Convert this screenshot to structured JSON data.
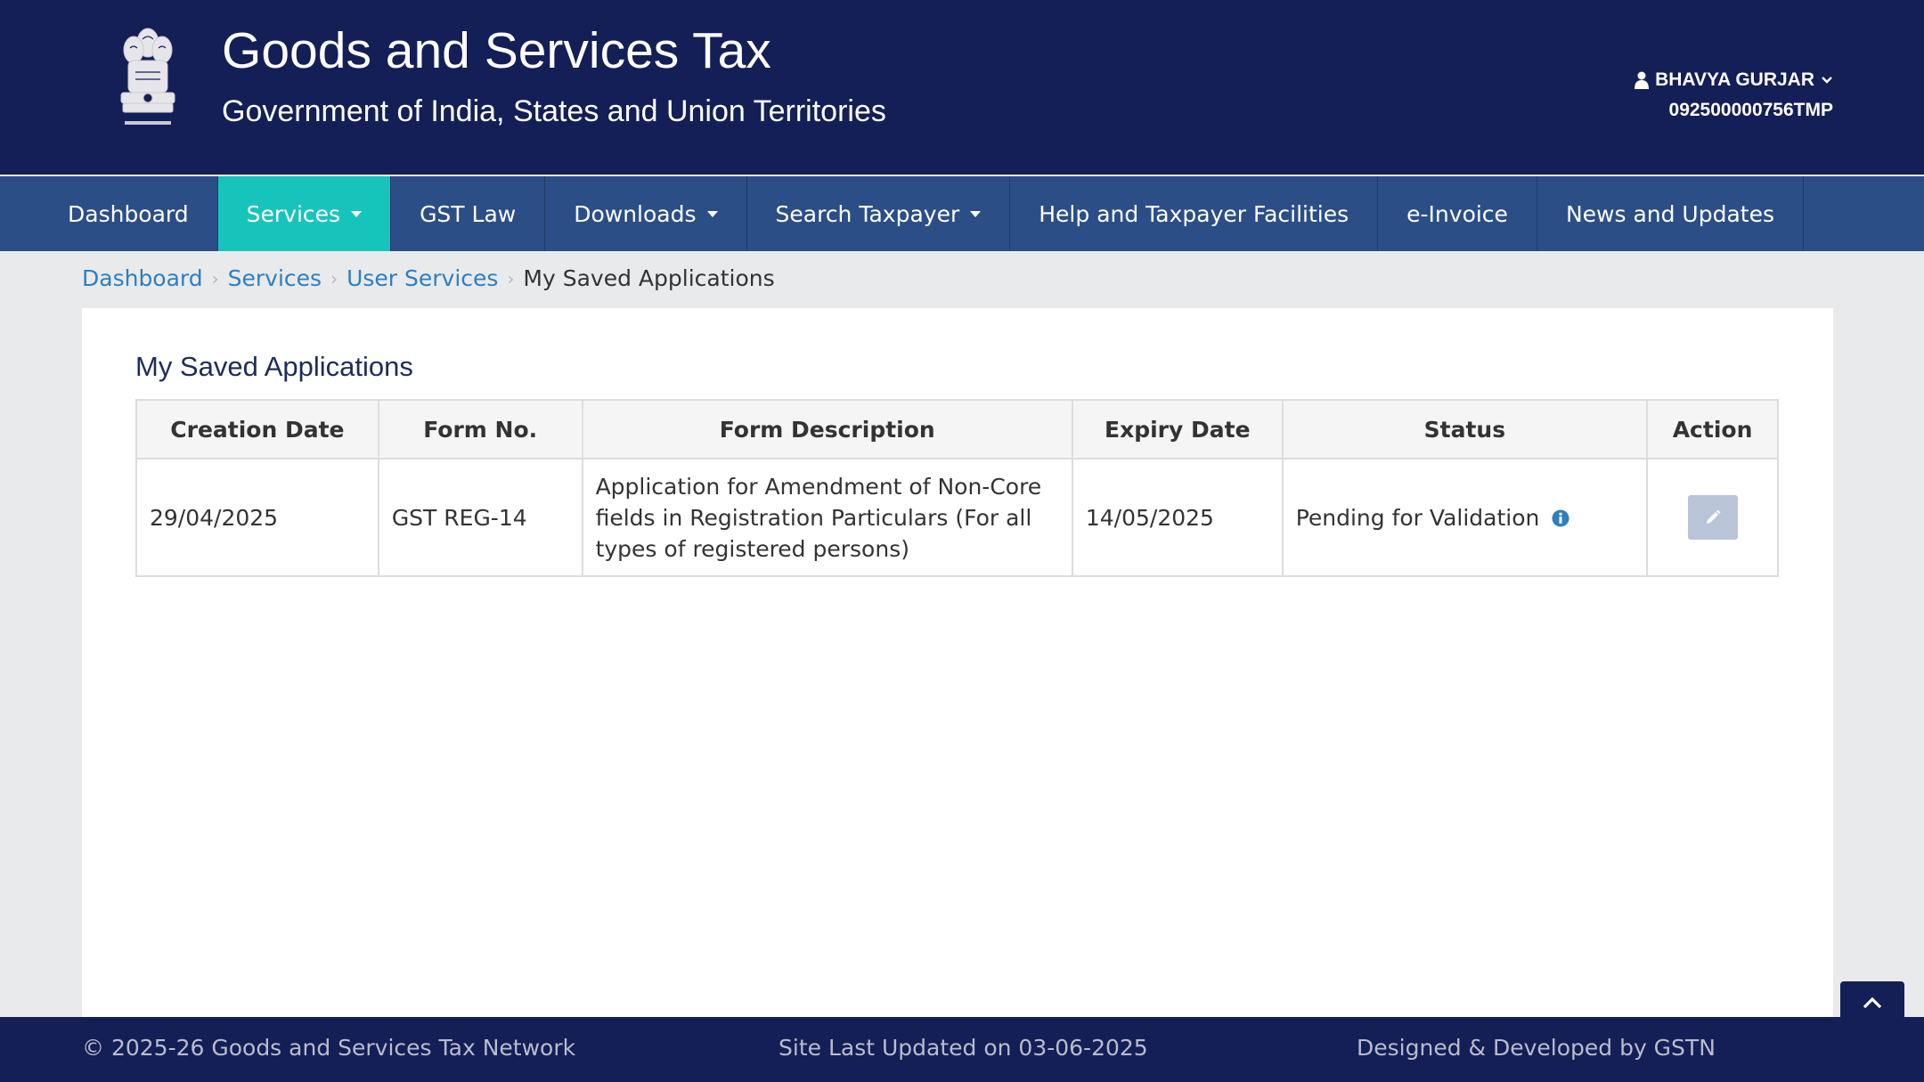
{
  "header": {
    "title": "Goods and Services Tax",
    "subtitle": "Government of India, States and Union Territories",
    "emblem_icon": "ashoka-emblem-icon",
    "user": {
      "name": "BHAVYA GURJAR",
      "id": "092500000756TMP"
    }
  },
  "nav": {
    "items": [
      {
        "label": "Dashboard",
        "has_dropdown": false
      },
      {
        "label": "Services",
        "has_dropdown": true,
        "active": true
      },
      {
        "label": "GST Law",
        "has_dropdown": false
      },
      {
        "label": "Downloads",
        "has_dropdown": true
      },
      {
        "label": "Search Taxpayer",
        "has_dropdown": true
      },
      {
        "label": "Help and Taxpayer Facilities",
        "has_dropdown": false
      },
      {
        "label": "e-Invoice",
        "has_dropdown": false
      },
      {
        "label": "News and Updates",
        "has_dropdown": false
      }
    ]
  },
  "breadcrumb": {
    "items": [
      "Dashboard",
      "Services",
      "User Services"
    ],
    "current": "My Saved Applications"
  },
  "main": {
    "title": "My Saved Applications",
    "table": {
      "columns": [
        "Creation Date",
        "Form No.",
        "Form Description",
        "Expiry Date",
        "Status",
        "Action"
      ],
      "rows": [
        {
          "creation_date": "29/04/2025",
          "form_no": "GST REG-14",
          "form_description": "Application for Amendment of Non-Core fields in Registration Particulars (For all types of registered persons)",
          "expiry_date": "14/05/2025",
          "status": "Pending for Validation",
          "action_icon": "pencil-icon"
        }
      ]
    }
  },
  "footer": {
    "copyright": "© 2025-26 Goods and Services Tax Network",
    "last_updated": "Site Last Updated on 03-06-2025",
    "designed_by": "Designed & Developed by GSTN"
  },
  "colors": {
    "header_bg": "#141f57",
    "nav_bg": "#2c4e86",
    "nav_active": "#17c4bb",
    "link": "#2d7fc1",
    "info_icon": "#2d7fc1"
  }
}
